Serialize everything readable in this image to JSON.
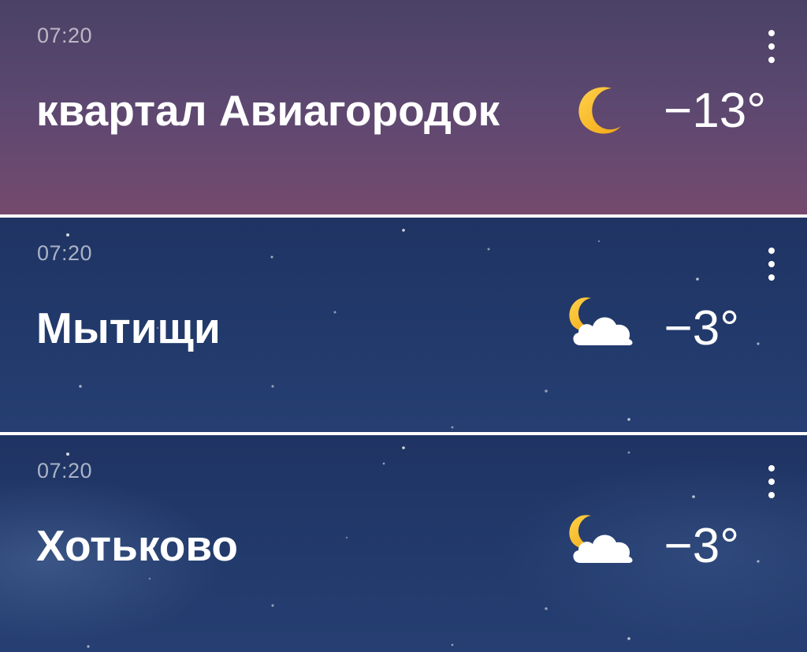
{
  "cities": [
    {
      "time": "07:20",
      "name": "квартал Авиагородок",
      "temperature": "−13°",
      "condition_icon": "moon-icon",
      "menu_icon": "more-vertical-icon"
    },
    {
      "time": "07:20",
      "name": "Мытищи",
      "temperature": "−3°",
      "condition_icon": "moon-cloud-icon",
      "menu_icon": "more-vertical-icon"
    },
    {
      "time": "07:20",
      "name": "Хотьково",
      "temperature": "−3°",
      "condition_icon": "moon-cloud-icon",
      "menu_icon": "more-vertical-icon"
    }
  ],
  "colors": {
    "card_1_top": "#4a4166",
    "card_1_bottom": "#744a6e",
    "night_blue": "#223a6c",
    "moon_yellow": "#f5b81c",
    "divider": "#ffffff"
  }
}
